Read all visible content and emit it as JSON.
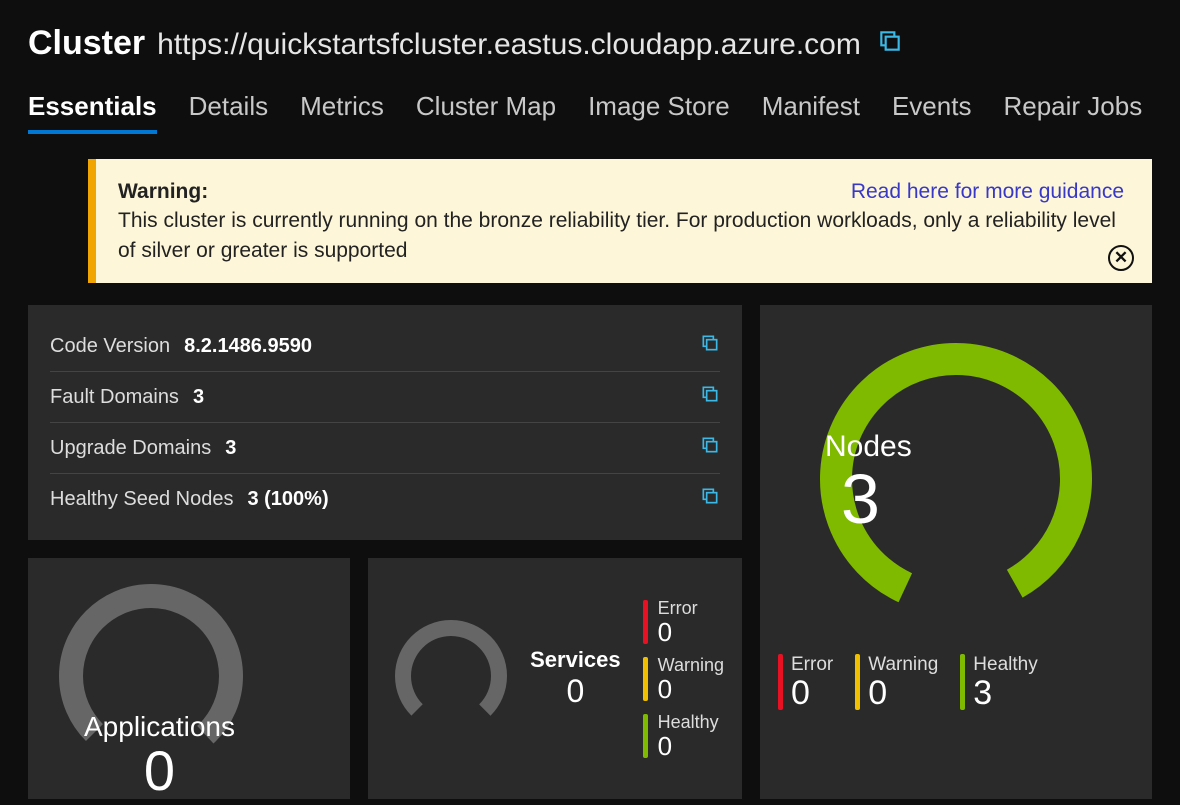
{
  "header": {
    "title": "Cluster",
    "url": "https://quickstartsfcluster.eastus.cloudapp.azure.com"
  },
  "tabs": [
    {
      "label": "Essentials",
      "active": true
    },
    {
      "label": "Details",
      "active": false
    },
    {
      "label": "Metrics",
      "active": false
    },
    {
      "label": "Cluster Map",
      "active": false
    },
    {
      "label": "Image Store",
      "active": false
    },
    {
      "label": "Manifest",
      "active": false
    },
    {
      "label": "Events",
      "active": false
    },
    {
      "label": "Repair Jobs",
      "active": false
    }
  ],
  "warning": {
    "label": "Warning:",
    "message": "This cluster is currently running on the bronze reliability tier. For production workloads, only a reliability level of silver or greater is supported",
    "link": "Read here for more guidance"
  },
  "info": {
    "code_version": {
      "label": "Code Version",
      "value": "8.2.1486.9590"
    },
    "fault_domains": {
      "label": "Fault Domains",
      "value": "3"
    },
    "upgrade_domains": {
      "label": "Upgrade Domains",
      "value": "3"
    },
    "healthy_seed": {
      "label": "Healthy Seed Nodes",
      "value": "3 (100%)"
    }
  },
  "applications": {
    "label": "Applications",
    "count": "0"
  },
  "services": {
    "label": "Services",
    "count": "0",
    "legend": {
      "error": {
        "label": "Error",
        "value": "0",
        "color": "#e81123"
      },
      "warning": {
        "label": "Warning",
        "value": "0",
        "color": "#f0c000"
      },
      "healthy": {
        "label": "Healthy",
        "value": "0",
        "color": "#7fba00"
      }
    }
  },
  "nodes": {
    "label": "Nodes",
    "count": "3",
    "legend": {
      "error": {
        "label": "Error",
        "value": "0",
        "color": "#e81123"
      },
      "warning": {
        "label": "Warning",
        "value": "0",
        "color": "#f0c000"
      },
      "healthy": {
        "label": "Healthy",
        "value": "3",
        "color": "#7fba00"
      }
    }
  },
  "chart_data": [
    {
      "type": "pie",
      "title": "Applications",
      "categories": [
        "Error",
        "Warning",
        "Healthy"
      ],
      "values": [
        0,
        0,
        0
      ],
      "total": 0
    },
    {
      "type": "pie",
      "title": "Services",
      "categories": [
        "Error",
        "Warning",
        "Healthy"
      ],
      "values": [
        0,
        0,
        0
      ],
      "total": 0
    },
    {
      "type": "pie",
      "title": "Nodes",
      "categories": [
        "Error",
        "Warning",
        "Healthy"
      ],
      "values": [
        0,
        0,
        3
      ],
      "total": 3
    }
  ],
  "colors": {
    "accent": "#0078d4",
    "icon": "#3bb8e6",
    "error": "#e81123",
    "warning": "#f0c000",
    "healthy": "#7fba00"
  }
}
